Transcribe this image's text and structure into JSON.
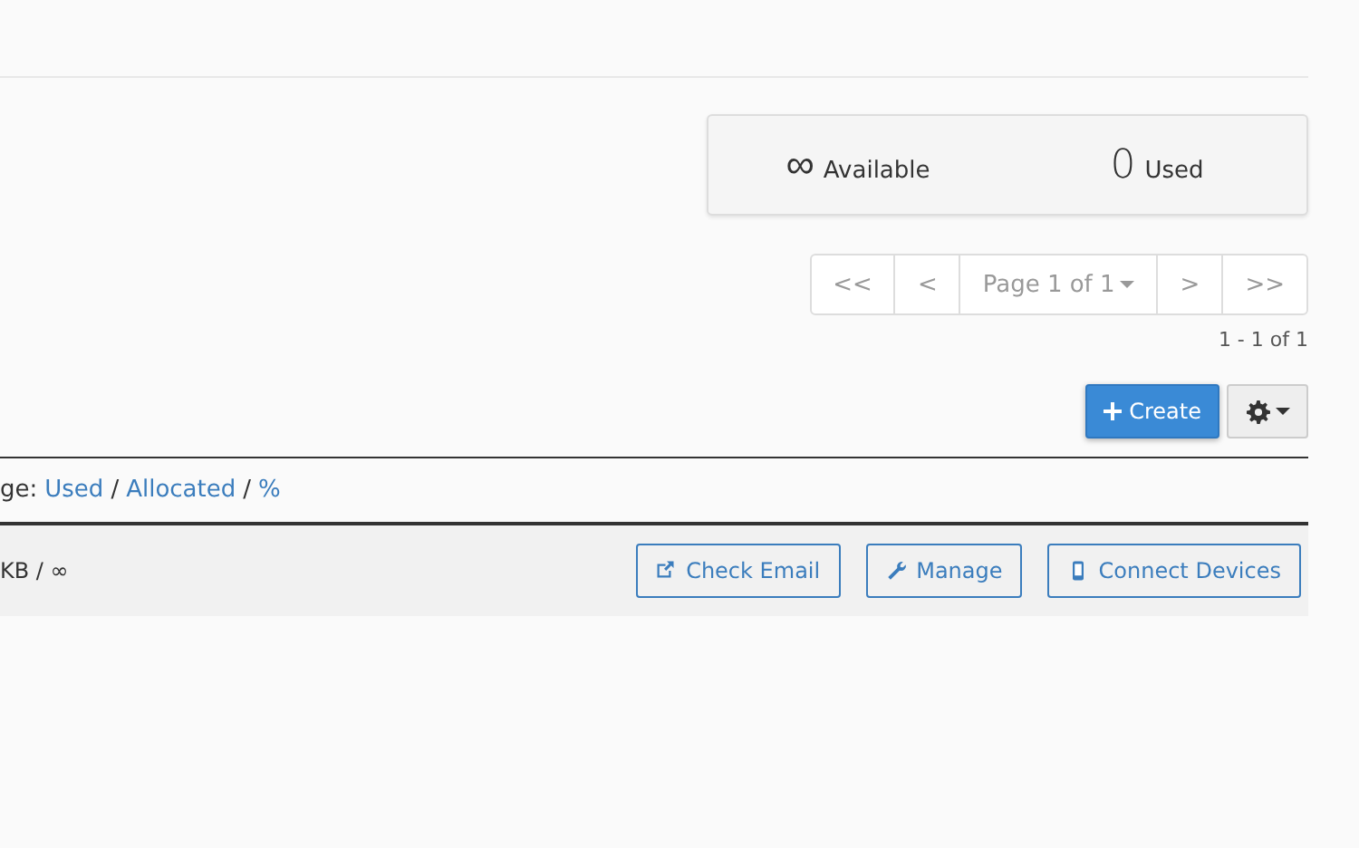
{
  "stats": [
    {
      "value": "∞",
      "label": "Available"
    },
    {
      "value": "0",
      "label": "Used"
    }
  ],
  "pager": {
    "first": "<<",
    "prev": "<",
    "page": "Page 1 of 1",
    "next": ">",
    "last": ">>",
    "range": "1 - 1 of 1"
  },
  "toolbar": {
    "create": "Create"
  },
  "table": {
    "header": [
      {
        "kind": "text",
        "text": "ge:"
      },
      {
        "kind": "link",
        "text": "Used"
      },
      {
        "kind": "text",
        "text": "/"
      },
      {
        "kind": "link",
        "text": "Allocated"
      },
      {
        "kind": "text",
        "text": "/"
      },
      {
        "kind": "link",
        "text": "%"
      }
    ],
    "rows": [
      {
        "usage": "KB / ∞",
        "actions": [
          {
            "kind": "external",
            "label": "Check Email"
          },
          {
            "kind": "wrench",
            "label": "Manage"
          },
          {
            "kind": "phone",
            "label": "Connect Devices"
          }
        ]
      }
    ]
  }
}
